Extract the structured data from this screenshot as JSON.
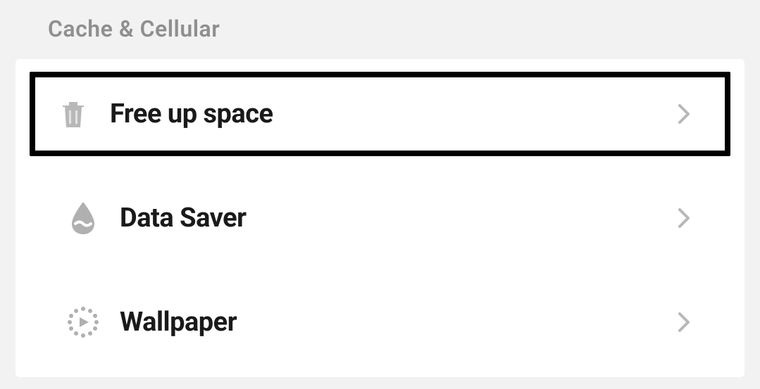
{
  "section": {
    "title": "Cache & Cellular"
  },
  "items": [
    {
      "label": "Free up space",
      "icon": "trash-icon",
      "highlighted": true
    },
    {
      "label": "Data Saver",
      "icon": "droplet-icon",
      "highlighted": false
    },
    {
      "label": "Wallpaper",
      "icon": "play-dotted-icon",
      "highlighted": false
    }
  ]
}
